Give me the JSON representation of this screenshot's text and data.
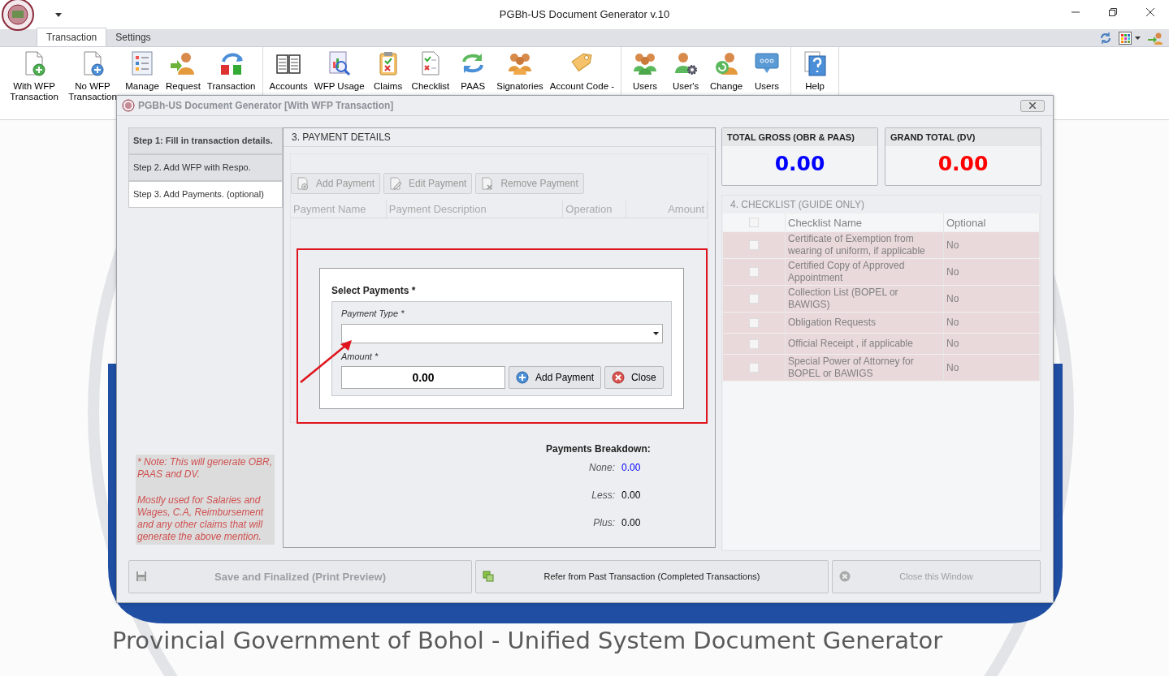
{
  "app": {
    "title": "PGBh-US Document Generator v.10"
  },
  "ribbon_tabs": [
    {
      "label": "Transaction",
      "selected": true
    },
    {
      "label": "Settings",
      "selected": false
    }
  ],
  "ribbon_groups": [
    {
      "buttons": [
        {
          "label": "With WFP Transaction"
        },
        {
          "label": "No WFP Transaction"
        },
        {
          "label": "Manage"
        },
        {
          "label": "Request"
        },
        {
          "label": "Transaction"
        }
      ]
    },
    {
      "buttons": [
        {
          "label": "Accounts"
        },
        {
          "label": "WFP Usage"
        },
        {
          "label": "Claims"
        },
        {
          "label": "Checklist"
        },
        {
          "label": "PAAS"
        },
        {
          "label": "Signatories"
        },
        {
          "label": "Account Code -"
        }
      ]
    },
    {
      "buttons": [
        {
          "label": "Users"
        },
        {
          "label": "User's"
        },
        {
          "label": "Change"
        },
        {
          "label": "Users"
        }
      ]
    },
    {
      "buttons": [
        {
          "label": "Help"
        }
      ]
    }
  ],
  "dialog": {
    "title": "PGBh-US Document Generator [With WFP Transaction]",
    "steps": [
      {
        "label": "Step 1: Fill in transaction details.",
        "bold": true,
        "selected": false
      },
      {
        "label": "Step 2. Add WFP with Respo.",
        "bold": false,
        "selected": false
      },
      {
        "label": "Step 3. Add Payments. (optional)",
        "bold": false,
        "selected": true
      }
    ],
    "note": [
      "* Note: This will generate OBR, PAAS and DV.",
      "Mostly used for Salaries and Wages, C.A, Reimbursement and any other claims that will generate the above mention."
    ],
    "payment_details": {
      "title": "3. PAYMENT DETAILS",
      "toolbar": [
        {
          "label": "Add Payment",
          "disabled": true
        },
        {
          "label": "Edit Payment",
          "disabled": true
        },
        {
          "label": "Remove Payment",
          "disabled": true
        }
      ],
      "columns": [
        "Payment Name",
        "Payment Description",
        "Operation",
        "Amount"
      ],
      "breakdown": {
        "title": "Payments Breakdown:",
        "rows": [
          {
            "label": "None:",
            "value": "0.00",
            "color": "#0000ff"
          },
          {
            "label": "Less:",
            "value": "0.00",
            "color": "#000000"
          },
          {
            "label": "Plus:",
            "value": "0.00",
            "color": "#000000"
          }
        ]
      }
    },
    "select_payments": {
      "title": "Select Payments *",
      "payment_type": {
        "label": "Payment Type *"
      },
      "amount": {
        "label": "Amount *",
        "value": "0.00"
      },
      "buttons": [
        {
          "label": "Add Payment",
          "kind": "add"
        },
        {
          "label": "Close",
          "kind": "close"
        }
      ]
    },
    "totals": [
      {
        "title": "TOTAL GROSS (OBR & PAAS)",
        "value": "0.00",
        "color": "#0000ff"
      },
      {
        "title": "GRAND TOTAL (DV)",
        "value": "0.00",
        "color": "#ff0000"
      }
    ],
    "checklist": {
      "title": "4. CHECKLIST (GUIDE ONLY)",
      "disabled": true,
      "header_checked": false,
      "columns": [
        "Checklist Name",
        "Optional"
      ],
      "rows": [
        {
          "name": "Certificate of Exemption from wearing of uniform, if applicable",
          "optional": "No",
          "checked": false
        },
        {
          "name": "Certified Copy of Approved Appointment",
          "optional": "No",
          "checked": false
        },
        {
          "name": "Collection List (BOPEL or BAWIGS)",
          "optional": "No",
          "checked": false
        },
        {
          "name": "Obligation Requests",
          "optional": "No",
          "checked": false
        },
        {
          "name": "Official Receipt , if applicable",
          "optional": "No",
          "checked": false
        },
        {
          "name": "Special Power of Attorney for BOPEL or BAWIGS",
          "optional": "No",
          "checked": false
        }
      ]
    },
    "footer_buttons": [
      {
        "label": "Save and Finalized (Print Preview)",
        "kind": "save",
        "disabled": true
      },
      {
        "label": "Refer from Past Transaction (Completed Transactions)",
        "kind": "refer",
        "disabled": false
      },
      {
        "label": "Close this Window",
        "kind": "close",
        "disabled": true
      }
    ]
  },
  "background_caption": "Provincial Government of Bohol - Unified System Document Generator"
}
